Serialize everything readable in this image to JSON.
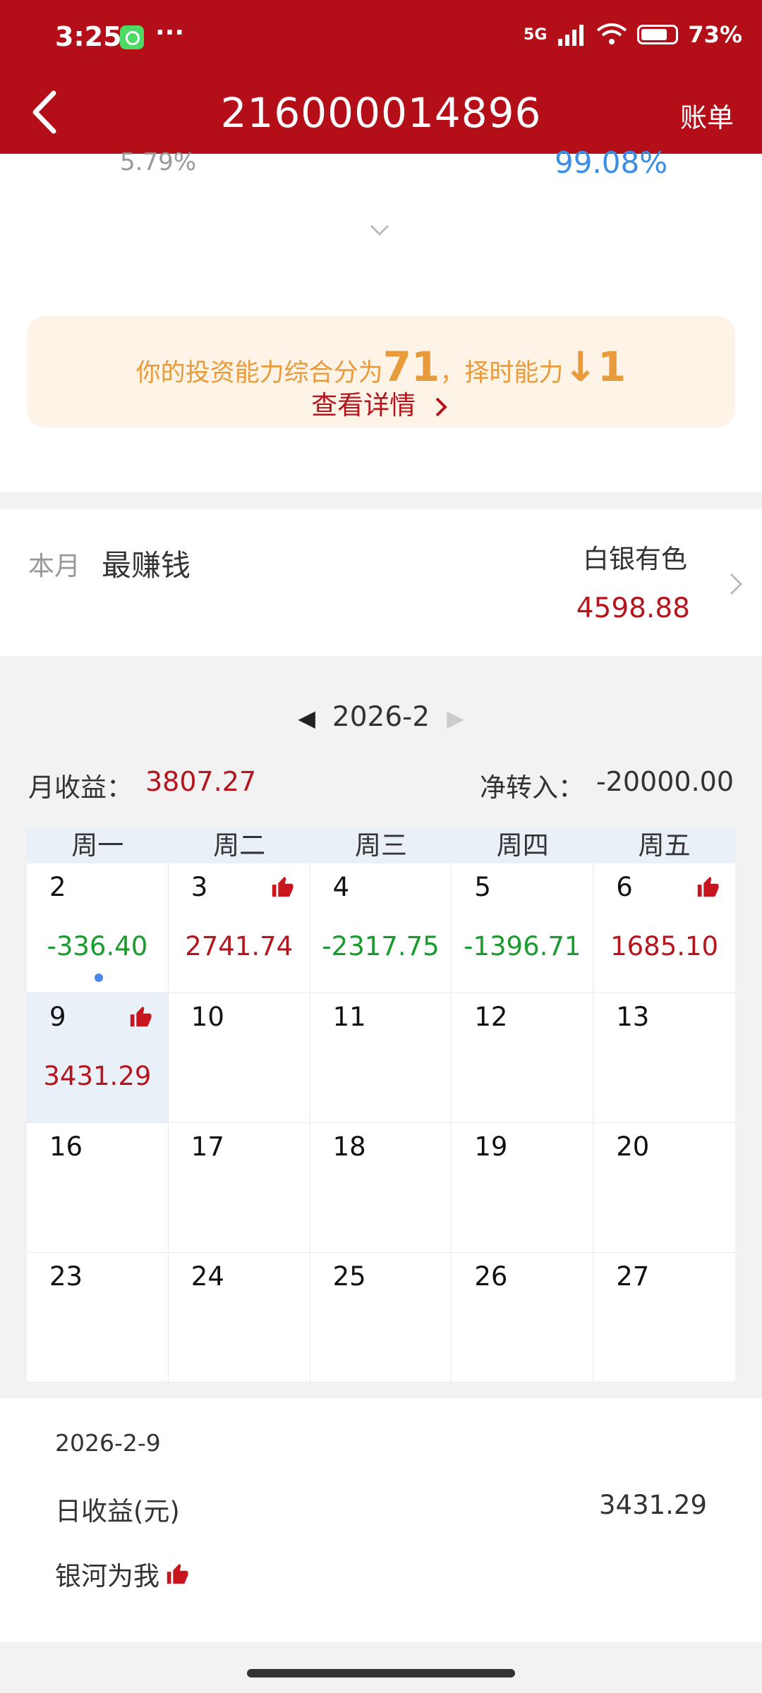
{
  "status_bar": {
    "time": "3:25",
    "dots": "···",
    "network": "5G",
    "battery": "73%"
  },
  "header": {
    "title": "216000014896",
    "bill_label": "账单"
  },
  "top_card": {
    "left_percent": "5.79%",
    "right_percent": "99.08%",
    "score_prefix": "你的投资能力综合分为",
    "score_value": "71",
    "score_mid": "，择时能力",
    "timing_value": "↓1",
    "detail_link": "查看详情"
  },
  "month_best": {
    "label": "本月",
    "title": "最赚钱",
    "name": "白银有色",
    "value": "4598.88"
  },
  "calendar": {
    "month": "2026-2",
    "monthly_income_label": "月收益：",
    "monthly_income_value": "3807.27",
    "net_transfer_label": "净转入：",
    "net_transfer_value": "-20000.00",
    "weekdays": [
      "周一",
      "周二",
      "周三",
      "周四",
      "周五"
    ],
    "cells": [
      {
        "day": "2",
        "value": "-336.40",
        "kind": "neg",
        "thumb": false,
        "dot": true
      },
      {
        "day": "3",
        "value": "2741.74",
        "kind": "pos",
        "thumb": true
      },
      {
        "day": "4",
        "value": "-2317.75",
        "kind": "neg",
        "thumb": false
      },
      {
        "day": "5",
        "value": "-1396.71",
        "kind": "neg",
        "thumb": false
      },
      {
        "day": "6",
        "value": "1685.10",
        "kind": "pos",
        "thumb": true
      },
      {
        "day": "9",
        "value": "3431.29",
        "kind": "pos",
        "thumb": true,
        "selected": true
      },
      {
        "day": "10",
        "value": ""
      },
      {
        "day": "11",
        "value": ""
      },
      {
        "day": "12",
        "value": ""
      },
      {
        "day": "13",
        "value": ""
      },
      {
        "day": "16",
        "value": ""
      },
      {
        "day": "17",
        "value": ""
      },
      {
        "day": "18",
        "value": ""
      },
      {
        "day": "19",
        "value": ""
      },
      {
        "day": "20",
        "value": ""
      },
      {
        "day": "23",
        "value": ""
      },
      {
        "day": "24",
        "value": ""
      },
      {
        "day": "25",
        "value": ""
      },
      {
        "day": "26",
        "value": ""
      },
      {
        "day": "27",
        "value": ""
      }
    ]
  },
  "detail": {
    "date": "2026-2-9",
    "daily_income_label": "日收益(元)",
    "daily_income_value": "3431.29",
    "tag": "银河为我"
  },
  "colors": {
    "header_bg": "#b40e19",
    "positive": "#b5161e",
    "negative": "#1a9b2e",
    "score": "#e99a3a"
  }
}
